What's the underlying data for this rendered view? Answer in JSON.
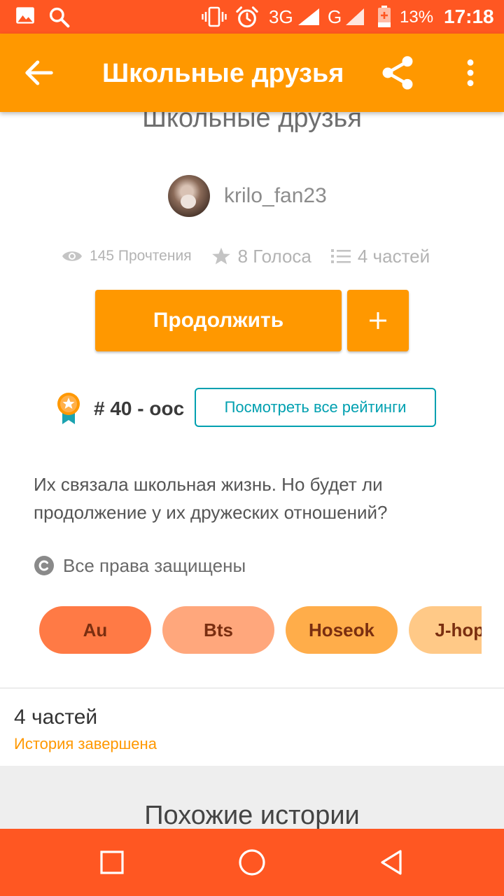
{
  "status_bar": {
    "network_3g": "3G",
    "network_g": "G",
    "battery_percent": "13%",
    "time": "17:18"
  },
  "app_bar": {
    "title": "Школьные друзья"
  },
  "story": {
    "title": "Школьные друзья",
    "author": "krilo_fan23",
    "reads": "145 Прочтения",
    "votes": "8 Голоса",
    "parts": "4 частей",
    "continue_label": "Продолжить",
    "rank": "# 40 - ooc",
    "view_ratings_label": "Посмотреть все рейтинги",
    "description": "Их связала школьная жизнь. Но будет ли продолжение у их дружеских отношений?",
    "copyright": "Все права защищены",
    "tags": [
      {
        "label": "Au",
        "color": "#ff7a45"
      },
      {
        "label": "Bts",
        "color": "#ffa77c"
      },
      {
        "label": "Hoseok",
        "color": "#ffad4a"
      },
      {
        "label": "J-hope",
        "color": "#ffc987"
      }
    ]
  },
  "parts_section": {
    "count": "4 частей",
    "status": "История завершена"
  },
  "similar": {
    "title": "Похожие истории"
  },
  "colors": {
    "status_bar": "#ff5722",
    "app_bar": "#ff9800",
    "accent_teal": "#00a0b0",
    "nav_bar": "#ff5722"
  }
}
